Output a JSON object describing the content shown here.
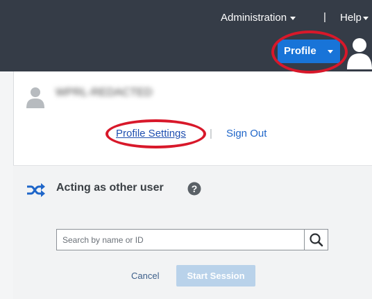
{
  "nav": {
    "administration_label": "Administration",
    "divider": "|",
    "help_label": "Help"
  },
  "profile_button": {
    "label": "Profile"
  },
  "user": {
    "name": "WPRL-REDACTED"
  },
  "links": {
    "profile_settings": "Profile Settings",
    "divider": "|",
    "sign_out": "Sign Out"
  },
  "acting": {
    "title": "Acting as other user",
    "search_placeholder": "Search by name or ID",
    "cancel_label": "Cancel",
    "start_label": "Start Session"
  },
  "icons": {
    "top_avatar": "user-avatar-icon",
    "small_avatar": "user-icon",
    "shuffle": "shuffle-icon",
    "help": "question-circle-icon",
    "search": "search-icon"
  },
  "colors": {
    "navbar": "#353c47",
    "profile_button": "#1874d8",
    "highlight": "#d8182a",
    "link": "#1f4fb0",
    "start_button_disabled": "#b9d2ea"
  }
}
